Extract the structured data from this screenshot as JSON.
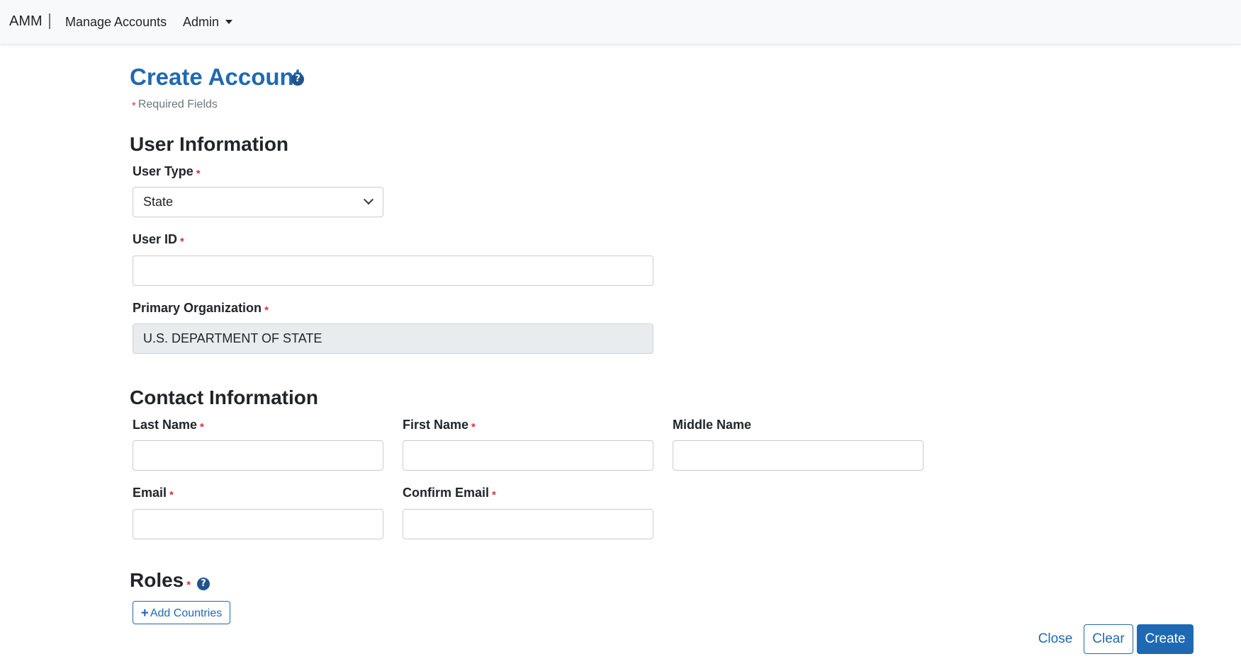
{
  "navbar": {
    "brand": "AMM",
    "manage_accounts": "Manage Accounts",
    "admin": "Admin"
  },
  "page": {
    "title": "Create Account",
    "help_icon": "?",
    "required_marker": "*",
    "required_note": "Required Fields"
  },
  "user_info": {
    "title": "User Information",
    "user_type_label": "User Type",
    "user_type_value": "State",
    "user_id_label": "User ID",
    "user_id_value": "",
    "primary_org_label": "Primary Organization",
    "primary_org_value": "U.S. DEPARTMENT OF STATE"
  },
  "contact_info": {
    "title": "Contact Information",
    "last_name_label": "Last Name",
    "first_name_label": "First Name",
    "middle_name_label": "Middle Name",
    "email_label": "Email",
    "confirm_email_label": "Confirm Email"
  },
  "roles": {
    "title": "Roles",
    "add_countries_label": "Add Countries",
    "plus_icon": "+"
  },
  "actions": {
    "close": "Close",
    "clear": "Clear",
    "create": "Create"
  },
  "colors": {
    "primary": "#1f69b3",
    "required": "#d9323a",
    "help_icon": "#20548e"
  },
  "icons": [
    "help-icon",
    "chevron-down-icon",
    "caret-down-icon",
    "plus-icon"
  ]
}
